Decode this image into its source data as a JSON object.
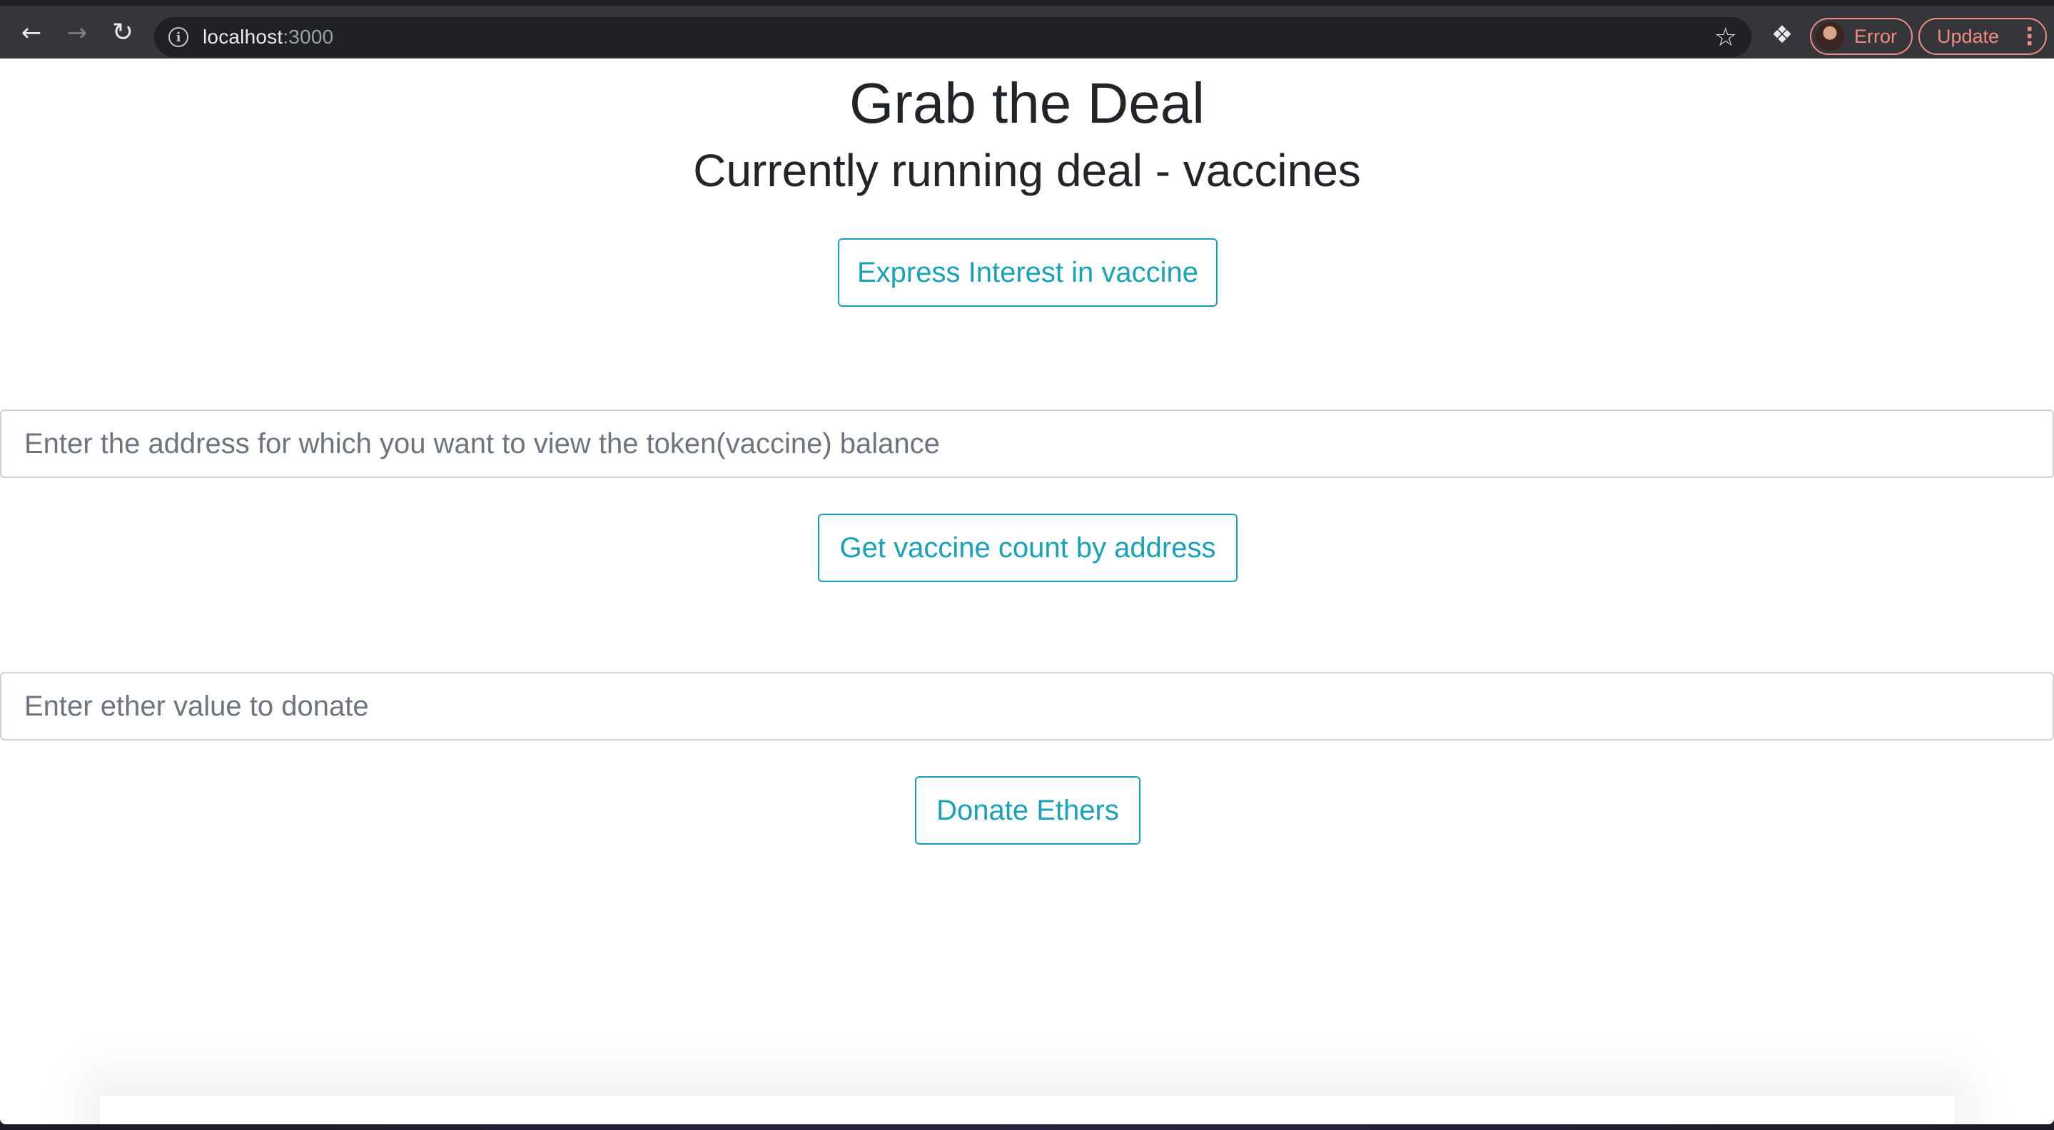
{
  "browser": {
    "url_host": "localhost",
    "url_port": ":3000",
    "profile_label": "Error",
    "update_label": "Update",
    "icons": {
      "back": "back-arrow-icon",
      "forward": "forward-arrow-icon",
      "reload": "reload-icon",
      "info": "info-icon",
      "bookmark": "star-icon",
      "extensions": "puzzle-icon",
      "menu": "kebab-menu-icon"
    }
  },
  "page": {
    "title": "Grab the Deal",
    "subtitle": "Currently running deal - vaccines",
    "express_interest_label": "Express Interest in vaccine",
    "address_input": {
      "placeholder": "Enter the address for which you want to view the token(vaccine) balance",
      "value": ""
    },
    "get_count_label": "Get vaccine count by address",
    "donate_input": {
      "placeholder": "Enter ether value to donate",
      "value": ""
    },
    "donate_label": "Donate Ethers"
  },
  "colors": {
    "accent": "#17a2b8",
    "text": "#212529",
    "chrome_bg": "#35363a",
    "error_accent": "#f28b82"
  }
}
